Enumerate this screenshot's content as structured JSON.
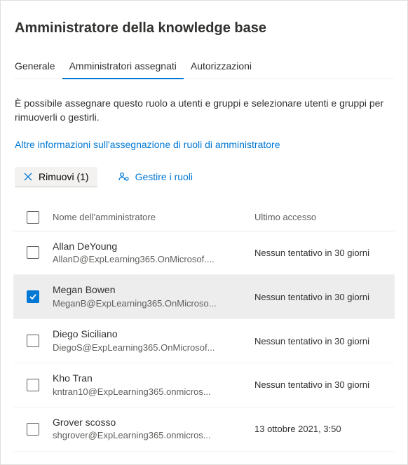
{
  "title": "Amministratore della knowledge base",
  "tabs": {
    "general": "Generale",
    "assigned": "Amministratori assegnati",
    "permissions": "Autorizzazioni"
  },
  "description": "È possibile assegnare questo ruolo a utenti e gruppi e selezionare utenti e gruppi per rimuoverli o gestirli.",
  "link": "Altre informazioni sull'assegnazione di ruoli di amministratore",
  "toolbar": {
    "remove_label": "Rimuovi (1)",
    "manage_label": "Gestire i ruoli"
  },
  "columns": {
    "name": "Nome dell'amministratore",
    "access": "Ultimo accesso"
  },
  "rows": [
    {
      "name": "Allan DeYoung",
      "email": "AllanD@ExpLearning365.OnMicrosof....",
      "access": "Nessun tentativo in 30 giorni",
      "selected": false
    },
    {
      "name": "Megan Bowen",
      "email": "MeganB@ExpLearning365.OnMicroso...",
      "access": "Nessun tentativo in 30 giorni",
      "selected": true
    },
    {
      "name": "Diego Siciliano",
      "email": "DiegoS@ExpLearning365.OnMicrosof...",
      "access": "Nessun tentativo in 30 giorni",
      "selected": false
    },
    {
      "name": "Kho Tran",
      "email": "kntran10@ExpLearning365.onmicros...",
      "access": "Nessun tentativo in 30 giorni",
      "selected": false
    },
    {
      "name": "Grover scosso",
      "email": "shgrover@ExpLearning365.onmicros...",
      "access": "13 ottobre 2021, 3:50",
      "selected": false
    }
  ]
}
